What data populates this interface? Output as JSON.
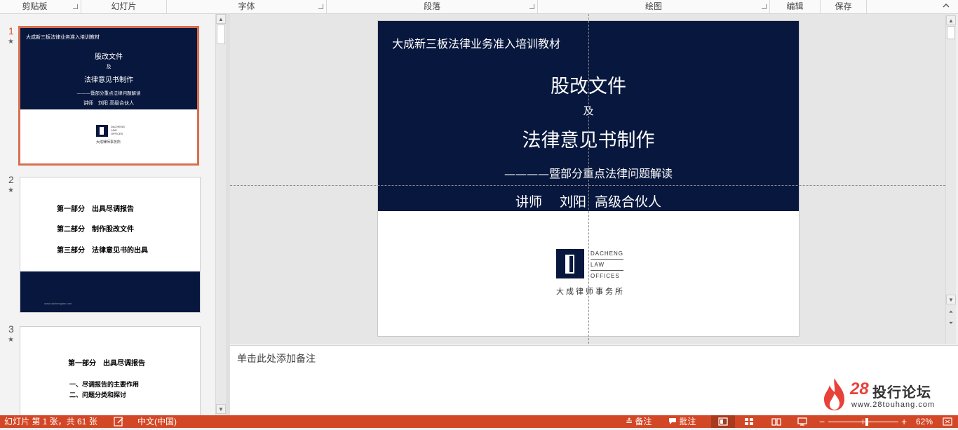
{
  "ribbon": {
    "groups": [
      "剪贴板",
      "幻灯片",
      "字体",
      "段落",
      "绘图",
      "编辑",
      "保存"
    ],
    "collapse_icon": "chevron-up-icon"
  },
  "thumbnails": [
    {
      "number": "1",
      "star": "★",
      "header": "大成新三板法律业务准入培训教材",
      "title1": "股改文件",
      "and": "及",
      "title2": "法律意见书制作",
      "subtitle": "———暨部分重点法律问题解读",
      "speaker": "讲师　刘阳 高级合伙人",
      "logo_lines": [
        "DACHENG",
        "LAW",
        "OFFICES"
      ],
      "logo_cn": "大成律师事务所"
    },
    {
      "number": "2",
      "star": "★",
      "items": [
        "第一部分　出具尽调报告",
        "第二部分　制作股改文件",
        "第三部分　法律意见书的出具"
      ],
      "footer": "www.dachenglaw.com"
    },
    {
      "number": "3",
      "star": "★",
      "heading": "第一部分　出具尽调报告",
      "items": [
        "一、尽调报告的主要作用",
        "二、问题分类和探讨"
      ]
    }
  ],
  "slide": {
    "header": "大成新三板法律业务准入培训教材",
    "title1": "股改文件",
    "and": "及",
    "title2": "法律意见书制作",
    "subtitle": "————暨部分重点法律问题解读",
    "speaker": "讲师　 刘阳  高级合伙人",
    "logo_lines": [
      "DACHENG",
      "LAW",
      "OFFICES"
    ],
    "logo_cn": "大成律师事务所"
  },
  "notes": {
    "placeholder": "单击此处添加备注"
  },
  "watermark": {
    "number": "28",
    "name": "投行论坛",
    "url": "www.28touhang.com"
  },
  "statusbar": {
    "slide_info": "幻灯片 第 1 张，共 61 张",
    "language": "中文(中国)",
    "notes_label": "备注",
    "comments_label": "批注",
    "zoom_minus": "−",
    "zoom_plus": "+",
    "zoom": "62%",
    "zoom_fraction": 0.55,
    "accent_color": "#d24726",
    "slide_bg_color": "#08173d"
  }
}
